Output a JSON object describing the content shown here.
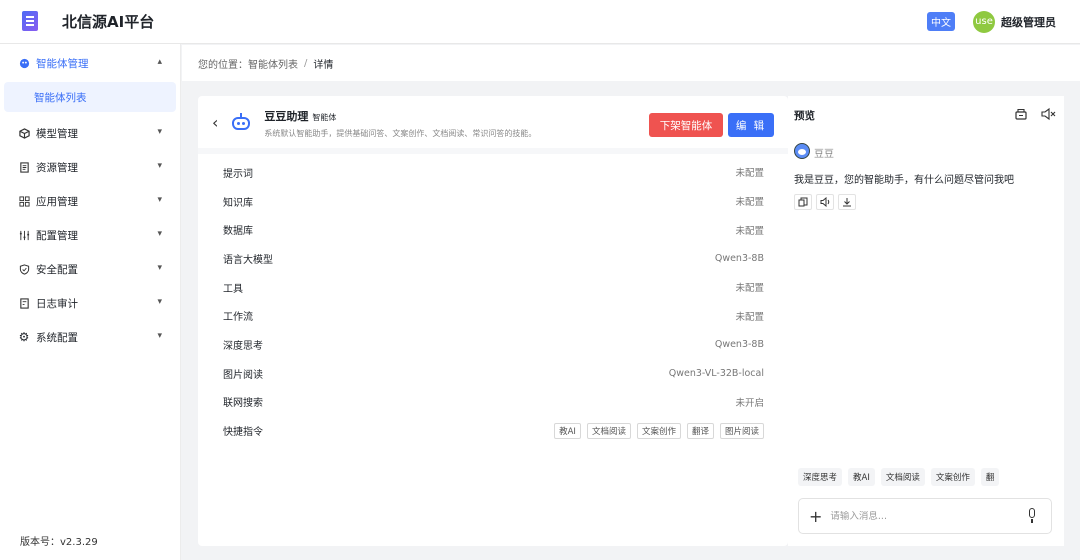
{
  "app": {
    "title": "北信源AI平台",
    "lang": "中文",
    "user_avatar_text": "use",
    "user_name": "超级管理员"
  },
  "sidebar": {
    "items": [
      {
        "label": "智能体管理",
        "icon": "brain-icon",
        "expanded": true
      },
      {
        "label": "模型管理",
        "icon": "cube-icon"
      },
      {
        "label": "资源管理",
        "icon": "document-icon"
      },
      {
        "label": "应用管理",
        "icon": "grid-icon"
      },
      {
        "label": "配置管理",
        "icon": "sliders-icon"
      },
      {
        "label": "安全配置",
        "icon": "shield-icon"
      },
      {
        "label": "日志审计",
        "icon": "log-icon"
      },
      {
        "label": "系统配置",
        "icon": "gear-icon"
      }
    ],
    "sub_item": "智能体列表",
    "version": "版本号：v2.3.29"
  },
  "breadcrumb": {
    "prefix": "您的位置：",
    "parent": "智能体列表",
    "sep": "/",
    "current": "详情"
  },
  "agent": {
    "name": "豆豆助理",
    "tag": "智能体",
    "description": "系统默认智能助手，提供基础问答、文案创作、文档阅读、常识问答的技能。",
    "unpublish_label": "下架智能体",
    "edit_label": "编 辑"
  },
  "config_rows": [
    {
      "label": "提示词",
      "value": "未配置"
    },
    {
      "label": "知识库",
      "value": "未配置"
    },
    {
      "label": "数据库",
      "value": "未配置"
    },
    {
      "label": "语言大模型",
      "value": "Qwen3-8B"
    },
    {
      "label": "工具",
      "value": "未配置"
    },
    {
      "label": "工作流",
      "value": "未配置"
    },
    {
      "label": "深度思考",
      "value": "Qwen3-8B"
    },
    {
      "label": "图片阅读",
      "value": "Qwen3-VL-32B-local"
    },
    {
      "label": "联网搜索",
      "value": "未开启"
    }
  ],
  "shortcuts": {
    "label": "快捷指令",
    "tags": [
      "教AI",
      "文档阅读",
      "文案创作",
      "翻译",
      "图片阅读"
    ]
  },
  "preview": {
    "title": "预览",
    "bot_name": "豆豆",
    "bot_message": "我是豆豆，您的智能助手，有什么问题尽管问我吧",
    "quick_actions": [
      "深度思考",
      "教AI",
      "文档阅读",
      "文案创作",
      "翻"
    ],
    "input_placeholder": "请输入消息..."
  },
  "colors": {
    "accent": "#3a6ff7",
    "danger": "#ef5350",
    "avatar": "#8fc940"
  }
}
